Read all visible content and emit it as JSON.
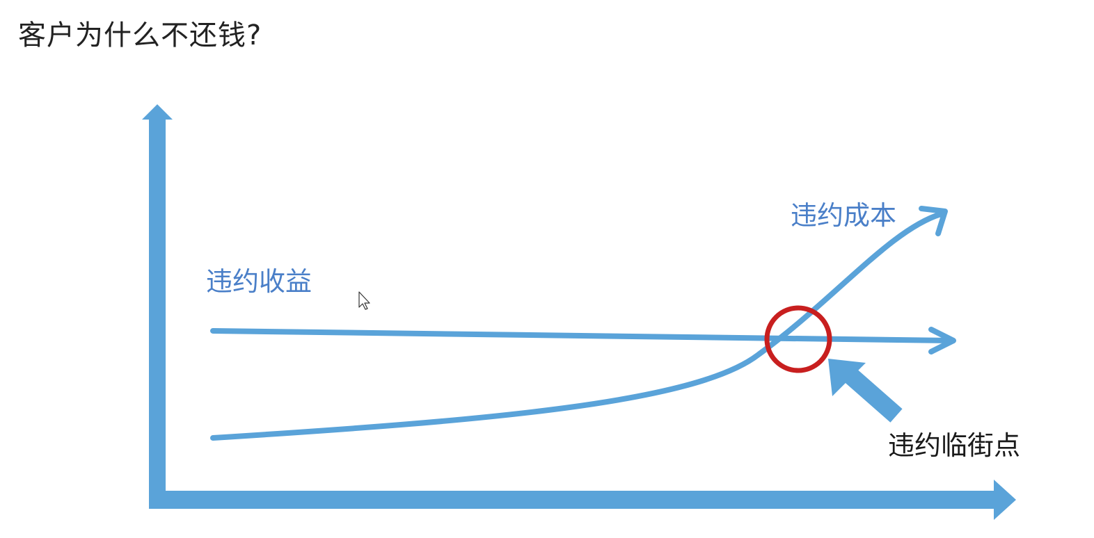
{
  "title": "客户为什么不还钱?",
  "labels": {
    "default_benefit": "违约收益",
    "default_cost": "违约成本",
    "critical_point": "违约临街点"
  },
  "colors": {
    "axis": "#5aa3d9",
    "curve": "#5aa3d9",
    "label_blue": "#4a7fc8",
    "label_dark": "#1a1a1a",
    "highlight_circle": "#c81f1f"
  }
}
